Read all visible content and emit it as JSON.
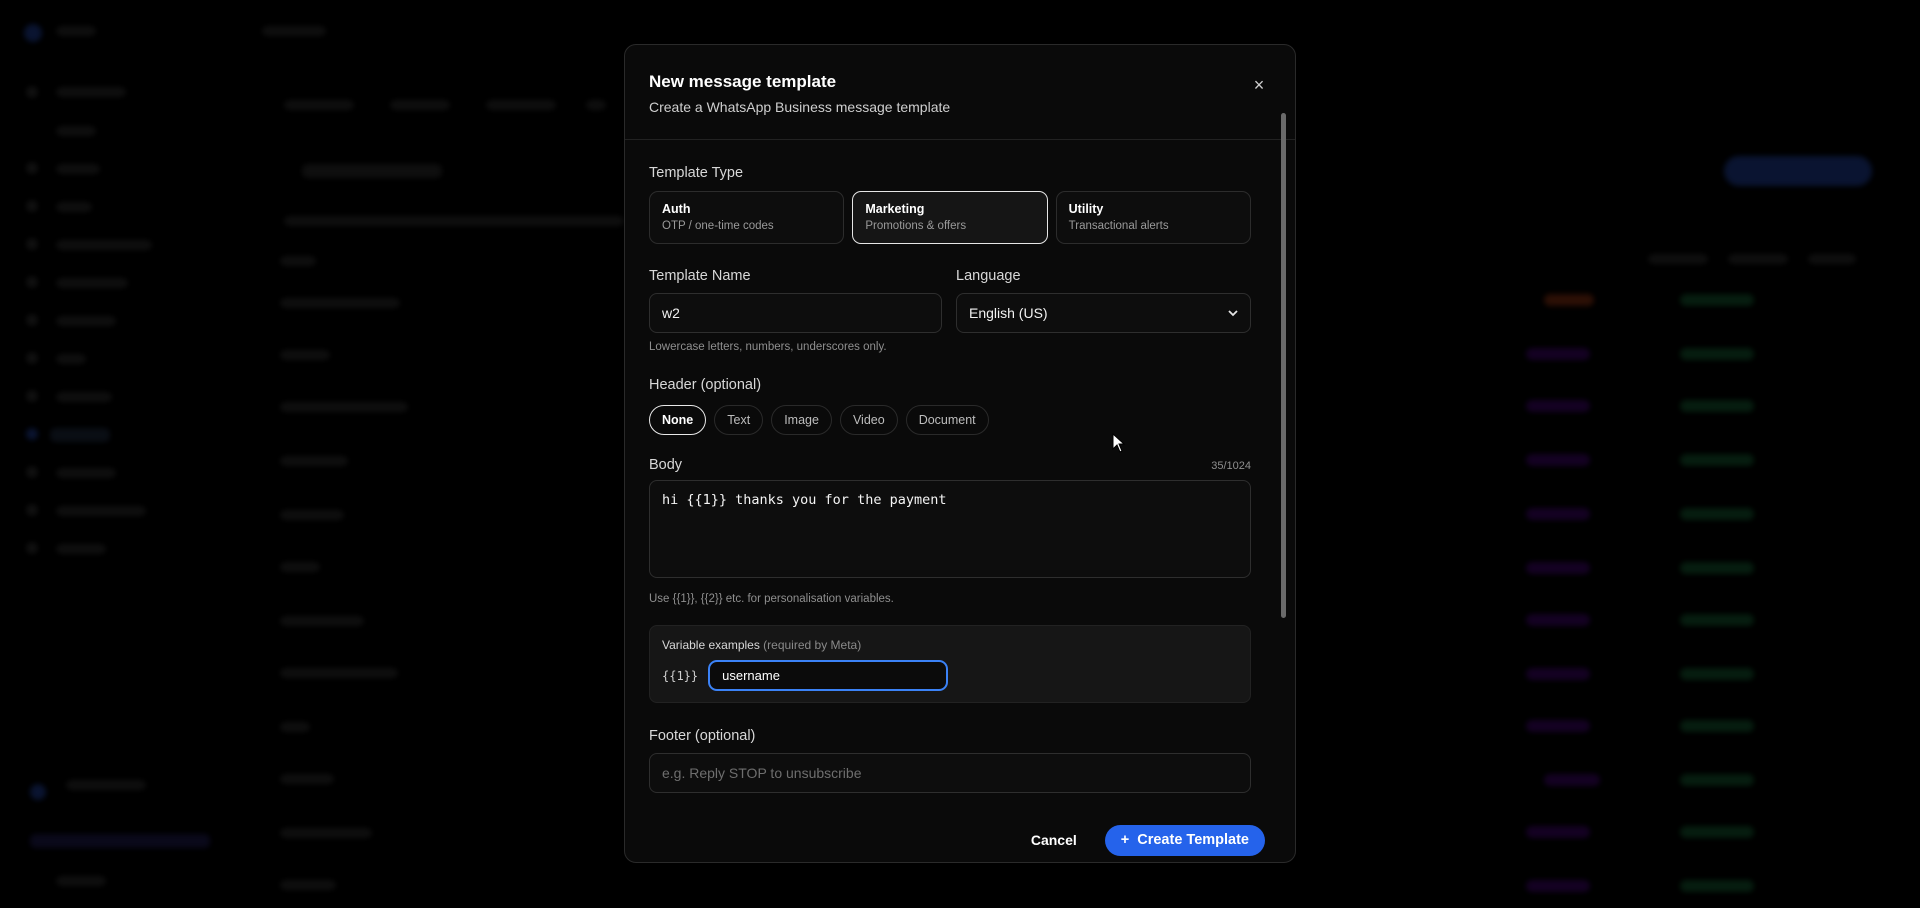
{
  "modal": {
    "title": "New message template",
    "subtitle": "Create a WhatsApp Business message template",
    "close_icon": "×"
  },
  "template_type": {
    "label": "Template Type",
    "options": [
      {
        "title": "Auth",
        "subtitle": "OTP / one-time codes",
        "selected": false
      },
      {
        "title": "Marketing",
        "subtitle": "Promotions & offers",
        "selected": true
      },
      {
        "title": "Utility",
        "subtitle": "Transactional alerts",
        "selected": false
      }
    ]
  },
  "template_name": {
    "label": "Template Name",
    "value": "w2",
    "hint": "Lowercase letters, numbers, underscores only."
  },
  "language": {
    "label": "Language",
    "value": "English (US)"
  },
  "header": {
    "label": "Header (optional)",
    "options": [
      "None",
      "Text",
      "Image",
      "Video",
      "Document"
    ],
    "selected": "None"
  },
  "body": {
    "label": "Body",
    "counter": "35/1024",
    "value": "hi {{1}} thanks you for the payment",
    "hint": "Use {{1}}, {{2}} etc. for personalisation variables."
  },
  "variables": {
    "title": "Variable examples",
    "title_note": "(required by Meta)",
    "items": [
      {
        "key": "{{1}}",
        "value": "username"
      }
    ]
  },
  "footer_field": {
    "label": "Footer (optional)",
    "placeholder": "e.g. Reply STOP to unsubscribe"
  },
  "actions": {
    "cancel_label": "Cancel",
    "create_label": "Create Template",
    "create_icon": "+"
  },
  "colors": {
    "accent": "#2563eb",
    "focus_ring": "#3b82f6"
  }
}
